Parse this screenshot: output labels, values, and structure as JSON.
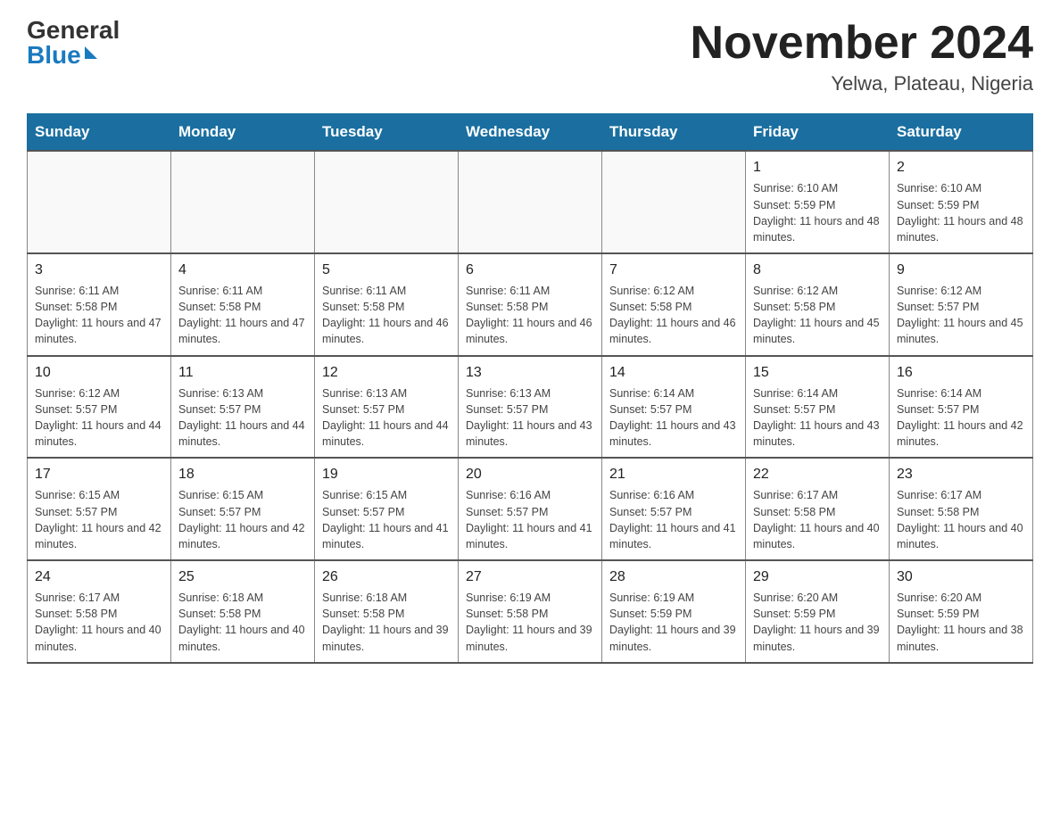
{
  "header": {
    "logo_general": "General",
    "logo_blue": "Blue",
    "month_title": "November 2024",
    "location": "Yelwa, Plateau, Nigeria"
  },
  "weekdays": [
    "Sunday",
    "Monday",
    "Tuesday",
    "Wednesday",
    "Thursday",
    "Friday",
    "Saturday"
  ],
  "weeks": [
    [
      {
        "day": "",
        "info": ""
      },
      {
        "day": "",
        "info": ""
      },
      {
        "day": "",
        "info": ""
      },
      {
        "day": "",
        "info": ""
      },
      {
        "day": "",
        "info": ""
      },
      {
        "day": "1",
        "info": "Sunrise: 6:10 AM\nSunset: 5:59 PM\nDaylight: 11 hours and 48 minutes."
      },
      {
        "day": "2",
        "info": "Sunrise: 6:10 AM\nSunset: 5:59 PM\nDaylight: 11 hours and 48 minutes."
      }
    ],
    [
      {
        "day": "3",
        "info": "Sunrise: 6:11 AM\nSunset: 5:58 PM\nDaylight: 11 hours and 47 minutes."
      },
      {
        "day": "4",
        "info": "Sunrise: 6:11 AM\nSunset: 5:58 PM\nDaylight: 11 hours and 47 minutes."
      },
      {
        "day": "5",
        "info": "Sunrise: 6:11 AM\nSunset: 5:58 PM\nDaylight: 11 hours and 46 minutes."
      },
      {
        "day": "6",
        "info": "Sunrise: 6:11 AM\nSunset: 5:58 PM\nDaylight: 11 hours and 46 minutes."
      },
      {
        "day": "7",
        "info": "Sunrise: 6:12 AM\nSunset: 5:58 PM\nDaylight: 11 hours and 46 minutes."
      },
      {
        "day": "8",
        "info": "Sunrise: 6:12 AM\nSunset: 5:58 PM\nDaylight: 11 hours and 45 minutes."
      },
      {
        "day": "9",
        "info": "Sunrise: 6:12 AM\nSunset: 5:57 PM\nDaylight: 11 hours and 45 minutes."
      }
    ],
    [
      {
        "day": "10",
        "info": "Sunrise: 6:12 AM\nSunset: 5:57 PM\nDaylight: 11 hours and 44 minutes."
      },
      {
        "day": "11",
        "info": "Sunrise: 6:13 AM\nSunset: 5:57 PM\nDaylight: 11 hours and 44 minutes."
      },
      {
        "day": "12",
        "info": "Sunrise: 6:13 AM\nSunset: 5:57 PM\nDaylight: 11 hours and 44 minutes."
      },
      {
        "day": "13",
        "info": "Sunrise: 6:13 AM\nSunset: 5:57 PM\nDaylight: 11 hours and 43 minutes."
      },
      {
        "day": "14",
        "info": "Sunrise: 6:14 AM\nSunset: 5:57 PM\nDaylight: 11 hours and 43 minutes."
      },
      {
        "day": "15",
        "info": "Sunrise: 6:14 AM\nSunset: 5:57 PM\nDaylight: 11 hours and 43 minutes."
      },
      {
        "day": "16",
        "info": "Sunrise: 6:14 AM\nSunset: 5:57 PM\nDaylight: 11 hours and 42 minutes."
      }
    ],
    [
      {
        "day": "17",
        "info": "Sunrise: 6:15 AM\nSunset: 5:57 PM\nDaylight: 11 hours and 42 minutes."
      },
      {
        "day": "18",
        "info": "Sunrise: 6:15 AM\nSunset: 5:57 PM\nDaylight: 11 hours and 42 minutes."
      },
      {
        "day": "19",
        "info": "Sunrise: 6:15 AM\nSunset: 5:57 PM\nDaylight: 11 hours and 41 minutes."
      },
      {
        "day": "20",
        "info": "Sunrise: 6:16 AM\nSunset: 5:57 PM\nDaylight: 11 hours and 41 minutes."
      },
      {
        "day": "21",
        "info": "Sunrise: 6:16 AM\nSunset: 5:57 PM\nDaylight: 11 hours and 41 minutes."
      },
      {
        "day": "22",
        "info": "Sunrise: 6:17 AM\nSunset: 5:58 PM\nDaylight: 11 hours and 40 minutes."
      },
      {
        "day": "23",
        "info": "Sunrise: 6:17 AM\nSunset: 5:58 PM\nDaylight: 11 hours and 40 minutes."
      }
    ],
    [
      {
        "day": "24",
        "info": "Sunrise: 6:17 AM\nSunset: 5:58 PM\nDaylight: 11 hours and 40 minutes."
      },
      {
        "day": "25",
        "info": "Sunrise: 6:18 AM\nSunset: 5:58 PM\nDaylight: 11 hours and 40 minutes."
      },
      {
        "day": "26",
        "info": "Sunrise: 6:18 AM\nSunset: 5:58 PM\nDaylight: 11 hours and 39 minutes."
      },
      {
        "day": "27",
        "info": "Sunrise: 6:19 AM\nSunset: 5:58 PM\nDaylight: 11 hours and 39 minutes."
      },
      {
        "day": "28",
        "info": "Sunrise: 6:19 AM\nSunset: 5:59 PM\nDaylight: 11 hours and 39 minutes."
      },
      {
        "day": "29",
        "info": "Sunrise: 6:20 AM\nSunset: 5:59 PM\nDaylight: 11 hours and 39 minutes."
      },
      {
        "day": "30",
        "info": "Sunrise: 6:20 AM\nSunset: 5:59 PM\nDaylight: 11 hours and 38 minutes."
      }
    ]
  ]
}
